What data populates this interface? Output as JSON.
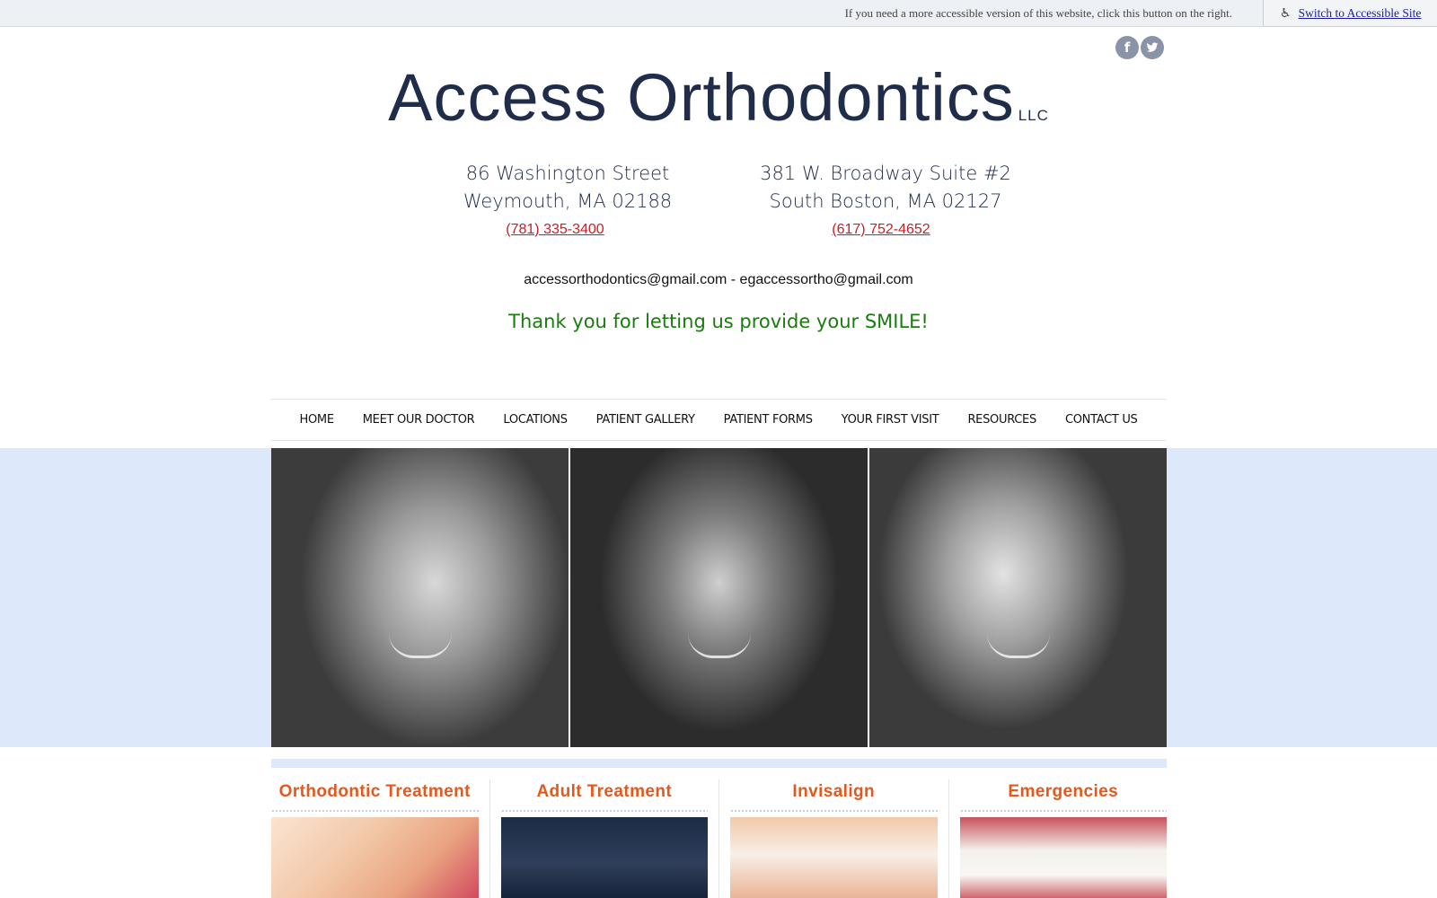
{
  "accessibility": {
    "message": "If you need a more accessible version of this website, click this button on the right.",
    "button_label": "Switch to Accessible Site",
    "icon": "wheelchair-icon"
  },
  "social": {
    "facebook_glyph": "f",
    "icons": [
      "facebook-icon",
      "twitter-icon"
    ]
  },
  "header": {
    "title": "Access Orthodontics",
    "suffix": "LLC"
  },
  "locations": [
    {
      "line1": "86 Washington Street",
      "line2": "Weymouth, MA 02188",
      "phone": "(781) 335-3400"
    },
    {
      "line1": "381 W. Broadway Suite #2",
      "line2": "South Boston, MA 02127",
      "phone": "(617) 752-4652"
    }
  ],
  "emails": "accessorthodontics@gmail.com - egaccessortho@gmail.com",
  "tagline": "Thank you for letting us provide your SMILE!",
  "nav": {
    "items": [
      "HOME",
      "MEET OUR DOCTOR",
      "LOCATIONS",
      "PATIENT GALLERY",
      "PATIENT FORMS",
      "YOUR FIRST VISIT",
      "RESOURCES",
      "CONTACT US"
    ]
  },
  "features": [
    {
      "title": "Orthodontic Treatment"
    },
    {
      "title": "Adult Treatment"
    },
    {
      "title": "Invisalign"
    },
    {
      "title": "Emergencies"
    }
  ],
  "colors": {
    "title": "#1f2d4b",
    "phone_link": "#c62027",
    "tagline": "#1b7a10",
    "feature_title": "#e4581c",
    "hero_band": "#dde9fb"
  }
}
